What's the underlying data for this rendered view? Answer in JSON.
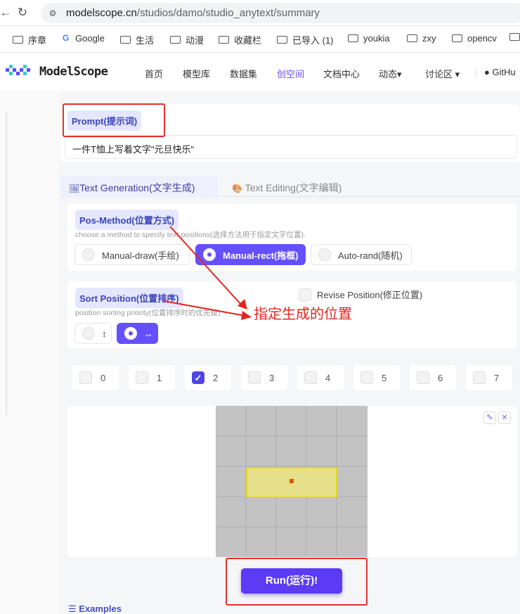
{
  "browser": {
    "url_host": "modelscope.cn",
    "url_path": "/studios/damo/studio_anytext/summary",
    "bookmarks": [
      "序章",
      "Google",
      "生活",
      "动漫",
      "收藏栏",
      "已导入 (1)",
      "youkia",
      "zxy",
      "opencv"
    ]
  },
  "site": {
    "logo_text": "ModelScope",
    "nav": [
      "首页",
      "模型库",
      "数据集",
      "创空间",
      "文档中心",
      "动态▾",
      "讨论区 ▾",
      "GitHu"
    ],
    "active_nav": "创空间"
  },
  "prompt": {
    "label": "Prompt(提示词)",
    "value": "一件T恤上写着文字\"元旦快乐\""
  },
  "tabs": {
    "generation": "Text Generation(文字生成)",
    "editing": "Text Editing(文字编辑)"
  },
  "pos_method": {
    "label": "Pos-Method(位置方式)",
    "hint": "choose a method to specify text positions(选择方法用于指定文字位置).",
    "options": [
      "Manual-draw(手绘)",
      "Manual-rect(拖框)",
      "Auto-rand(随机)"
    ],
    "selected": "Manual-rect(拖框)"
  },
  "sort_position": {
    "label": "Sort Position(位置排序)",
    "hint": "position sorting priority(位置排序时的优先级)",
    "options": [
      "↕",
      "↔"
    ],
    "selected": "↔"
  },
  "revise_position": {
    "label": "Revise Position(修正位置)",
    "checked": false
  },
  "count_options": {
    "items": [
      "0",
      "1",
      "2",
      "3",
      "4",
      "5",
      "6",
      "7"
    ],
    "checked": "2"
  },
  "canvas": {
    "edit_icon": "pencil-icon",
    "close_icon": "close-icon",
    "grid_cols": 5,
    "grid_rows": 5,
    "grid_color": "#c3c3c3",
    "rect_color": "#e6e08a"
  },
  "run_button": "Run(运行)!",
  "examples_label": "Examples",
  "annotation": {
    "text": "指定生成的位置",
    "color": "#e3261e"
  }
}
